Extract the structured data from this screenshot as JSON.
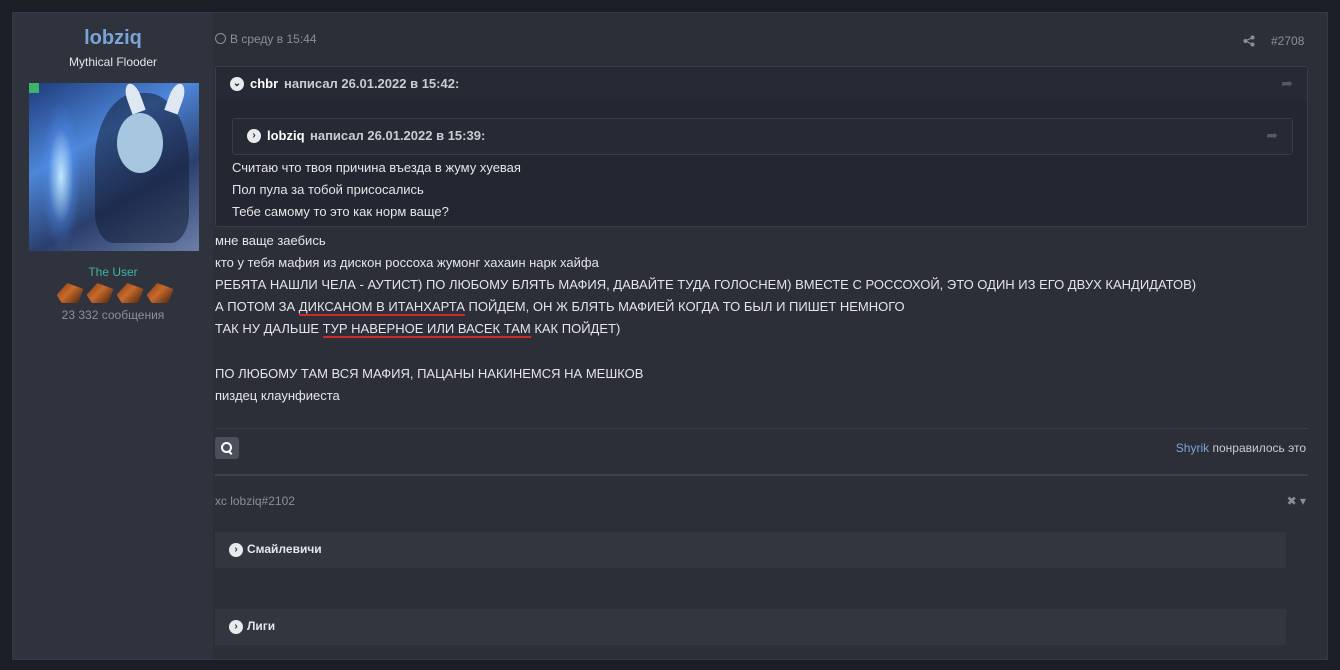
{
  "user": {
    "name": "lobziq",
    "title": "Mythical Flooder",
    "role": "The User",
    "messages": "23 332 сообщения"
  },
  "post": {
    "date": "В среду в 15:44",
    "number": "#2708"
  },
  "quote_outer": {
    "author": "chbr",
    "wrote": "написал 26.01.2022 в 15:42:",
    "lines": [
      "Считаю что твоя причина въезда в жуму хуевая",
      "Пол пула за тобой присосались",
      "Тебе самому то это как норм ваще?"
    ]
  },
  "quote_inner": {
    "author": "lobziq",
    "wrote": "написал 26.01.2022 в 15:39:"
  },
  "body": {
    "line1": "мне ваще заебись",
    "line2": "кто у тебя мафия из дискон россоха жумонг хахаин нарк хайфа",
    "line3": "РЕБЯТА НАШЛИ ЧЕЛА - АУТИСТ) ПО ЛЮБОМУ БЛЯТЬ МАФИЯ, ДАВАЙТЕ ТУДА ГОЛОСНЕМ) ВМЕСТЕ С РОССОХОЙ, ЭТО ОДИН ИЗ ЕГО ДВУХ КАНДИДАТОВ)",
    "line4a": "А ПОТОМ ЗА ",
    "line4b": "ДИКСАНОМ В ИТАНХАРТА",
    "line4c": " ПОЙДЕМ, ОН Ж БЛЯТЬ МАФИЕЙ КОГДА ТО БЫЛ И ПИШЕТ НЕМНОГО",
    "line5a": "ТАК НУ ДАЛЬШЕ ",
    "line5b": "ТУР НАВЕРНОЕ ИЛИ ВАСЕК ТАМ",
    "line5c": " КАК ПОЙДЕТ)",
    "line6": "ПО ЛЮБОМУ ТАМ ВСЯ МАФИЯ, ПАЦАНЫ НАКИНЕМСЯ НА МЕШКОВ",
    "line7": "пиздец клаунфиеста"
  },
  "likes": {
    "user": "Shyrik",
    "text": " понравилось это"
  },
  "signature": {
    "text": "хс lobziq#2102",
    "spoilers": [
      "Смайлевичи",
      "Лиги"
    ]
  },
  "colors": {
    "accent": "#7aa4d8",
    "role": "#3fb5a3",
    "underline": "#cc2a2a"
  }
}
